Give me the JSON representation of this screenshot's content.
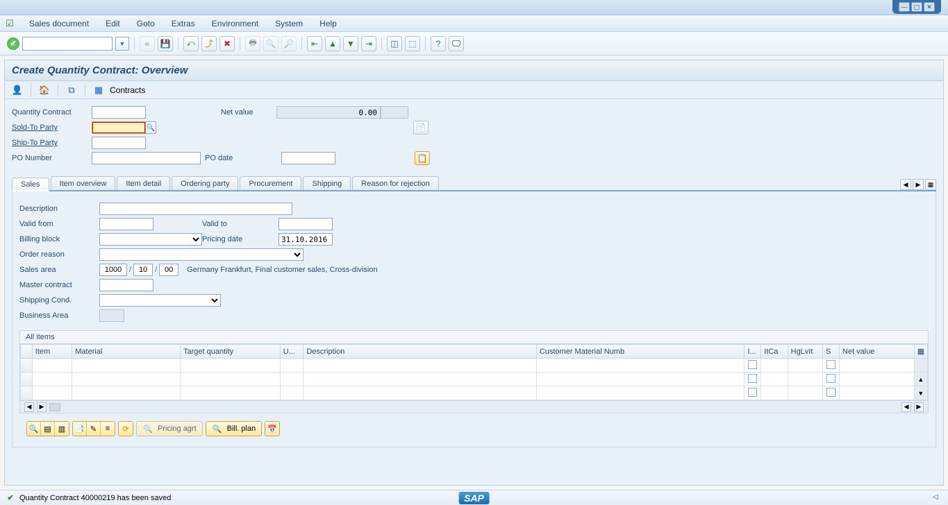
{
  "menu": {
    "items": [
      "Sales document",
      "Edit",
      "Goto",
      "Extras",
      "Environment",
      "System",
      "Help"
    ]
  },
  "page": {
    "title": "Create Quantity Contract: Overview"
  },
  "subtoolbar": {
    "contracts": "Contracts"
  },
  "header": {
    "quantity_contract_label": "Quantity Contract",
    "quantity_contract": "",
    "net_value_label": "Net value",
    "net_value": "0.00",
    "currency": "",
    "sold_to_label": "Sold-To Party",
    "sold_to": "",
    "ship_to_label": "Ship-To Party",
    "ship_to": "",
    "po_number_label": "PO Number",
    "po_number": "",
    "po_date_label": "PO date",
    "po_date": ""
  },
  "tabs": [
    "Sales",
    "Item overview",
    "Item detail",
    "Ordering party",
    "Procurement",
    "Shipping",
    "Reason for rejection"
  ],
  "sales": {
    "description_label": "Description",
    "description": "",
    "valid_from_label": "Valid from",
    "valid_from": "",
    "valid_to_label": "Valid to",
    "valid_to": "",
    "billing_block_label": "Billing block",
    "billing_block": "",
    "pricing_date_label": "Pricing date",
    "pricing_date": "31.10.2016",
    "order_reason_label": "Order reason",
    "order_reason": "",
    "sales_area_label": "Sales area",
    "sales_org": "1000",
    "dist_channel": "10",
    "division": "00",
    "sales_area_desc": "Germany Frankfurt, Final customer sales, Cross-division",
    "master_contract_label": "Master contract",
    "master_contract": "",
    "shipping_cond_label": "Shipping Cond.",
    "shipping_cond": "",
    "business_area_label": "Business Area",
    "business_area": ""
  },
  "grid": {
    "title": "All items",
    "columns": [
      "Item",
      "Material",
      "Target quantity",
      "U...",
      "Description",
      "Customer Material Numb",
      "I...",
      "ItCa",
      "HgLvIt",
      "S",
      "Net value"
    ]
  },
  "bottom": {
    "pricing_agrt": "Pricing agrt",
    "bill_plan": "Bill. plan"
  },
  "status": {
    "message": "Quantity Contract 40000219 has been saved"
  }
}
